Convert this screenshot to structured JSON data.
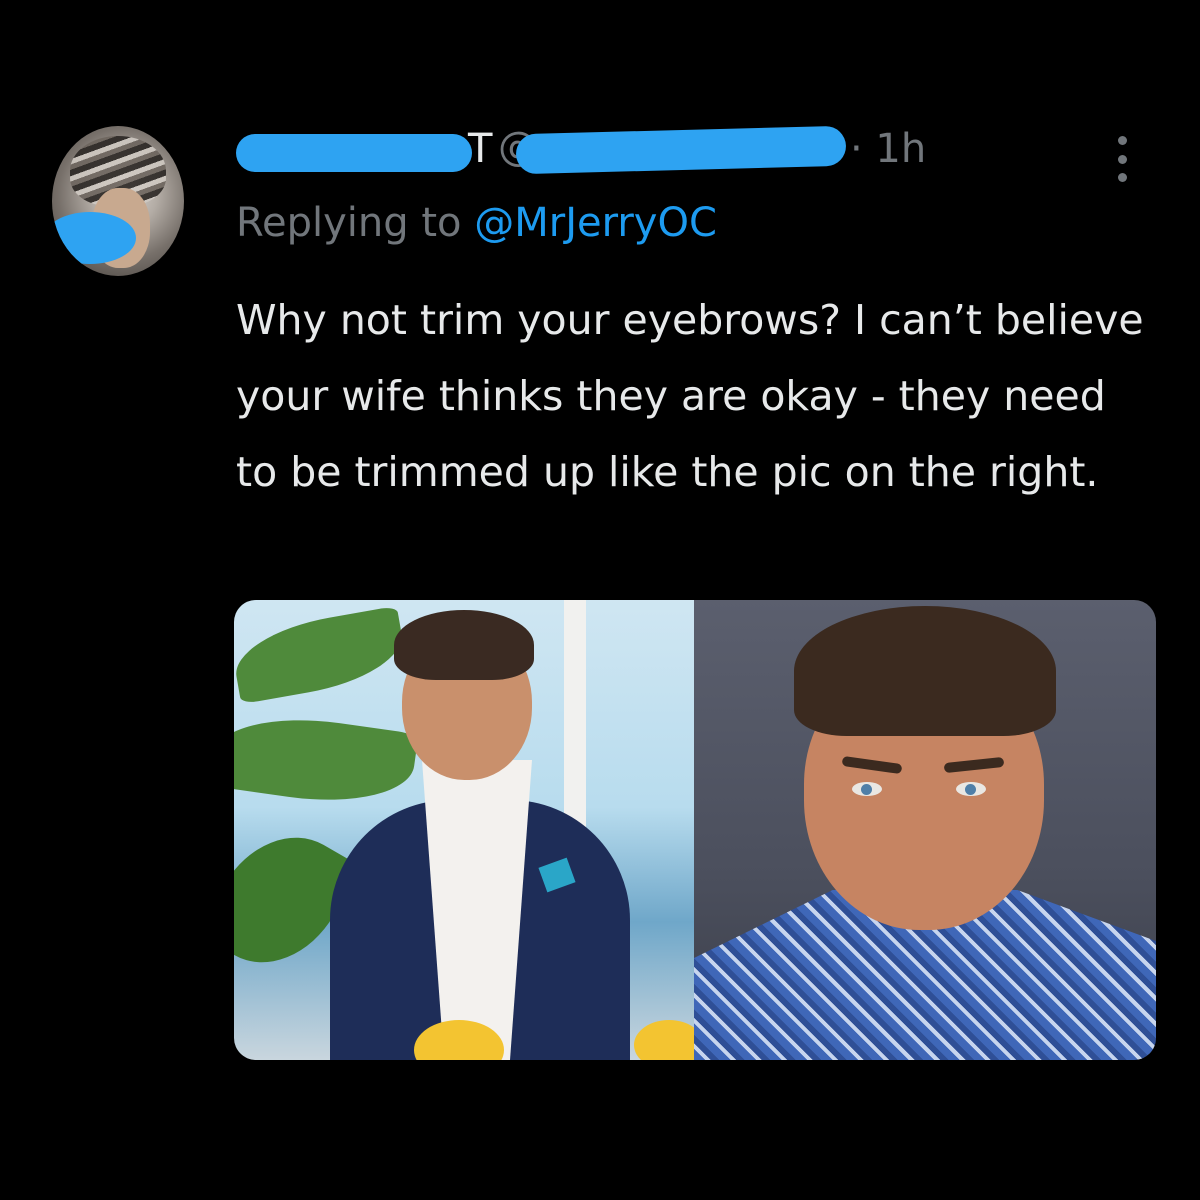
{
  "tweet": {
    "author_name_visible": "T",
    "handle_at": "@",
    "time": "· 1h",
    "reply_prefix": "Replying to ",
    "reply_mention": "@MrJerryOC",
    "text": "Why not trim your eyebrows? I can’t believe your wife thinks they are okay - they need to be trimmed up like the pic on the right."
  },
  "colors": {
    "background": "#000000",
    "text": "#e7e9ea",
    "secondary": "#71767b",
    "link": "#1d9bf0",
    "redaction": "#2ea3f2"
  },
  "icons": {
    "more": "more-options-icon"
  }
}
